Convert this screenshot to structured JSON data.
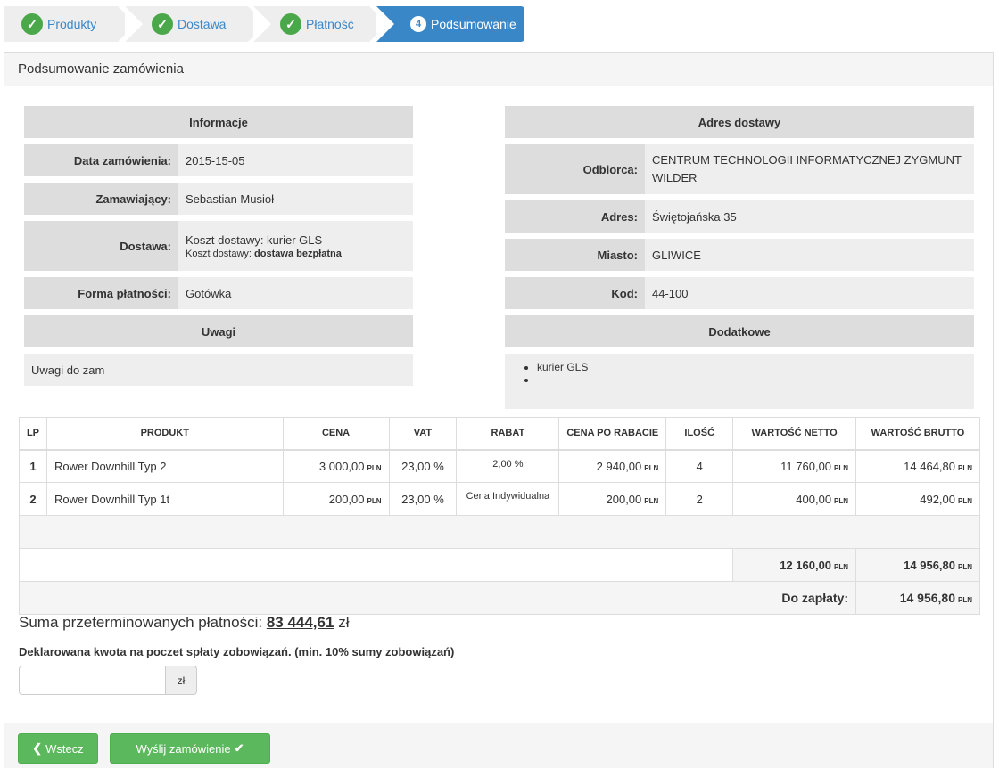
{
  "wizard": {
    "steps": [
      {
        "label": "Produkty"
      },
      {
        "label": "Dostawa"
      },
      {
        "label": "Płatność"
      },
      {
        "label": "Podsumowanie",
        "number": "4"
      }
    ]
  },
  "panel": {
    "title": "Podsumowanie zamówienia"
  },
  "info": {
    "header": "Informacje",
    "rows": [
      {
        "label": "Data zamówienia:",
        "value": "2015-15-05"
      },
      {
        "label": "Zamawiający:",
        "value": "Sebastian Musioł"
      },
      {
        "label": "Dostawa:",
        "value": "Koszt dostawy: kurier GLS",
        "sub_label": "Koszt dostawy:",
        "sub_value": "dostawa bezpłatna"
      },
      {
        "label": "Forma płatności:",
        "value": "Gotówka"
      }
    ],
    "notes_header": "Uwagi",
    "notes": "Uwagi do zam"
  },
  "address": {
    "header": "Adres dostawy",
    "rows": [
      {
        "label": "Odbiorca:",
        "value": "CENTRUM TECHNOLOGII INFORMATYCZNEJ ZYGMUNT WILDER"
      },
      {
        "label": "Adres:",
        "value": "Świętojańska 35"
      },
      {
        "label": "Miasto:",
        "value": "GLIWICE"
      },
      {
        "label": "Kod:",
        "value": "44-100"
      }
    ],
    "extra_header": "Dodatkowe",
    "extra_items": [
      "kurier GLS",
      ""
    ]
  },
  "table": {
    "headers": [
      "LP",
      "PRODUKT",
      "CENA",
      "VAT",
      "RABAT",
      "CENA PO RABACIE",
      "ILOŚĆ",
      "WARTOŚĆ NETTO",
      "WARTOŚĆ BRUTTO"
    ],
    "currency": "PLN",
    "rows": [
      {
        "lp": "1",
        "product": "Rower Downhill Typ 2",
        "price": "3 000,00",
        "vat": "23,00 %",
        "discount": "2,00 %",
        "price_after": "2 940,00",
        "qty": "4",
        "net": "11 760,00",
        "gross": "14 464,80"
      },
      {
        "lp": "2",
        "product": "Rower Downhill Typ 1t",
        "price": "200,00",
        "vat": "23,00 %",
        "discount": "Cena Indywidualna",
        "price_after": "200,00",
        "qty": "2",
        "net": "400,00",
        "gross": "492,00"
      }
    ],
    "total_net": "12 160,00",
    "total_gross": "14 956,80",
    "to_pay_label": "Do zapłaty:",
    "to_pay": "14 956,80"
  },
  "overdue": {
    "label": "Suma przeterminowanych płatności:",
    "amount": "83 444,61",
    "currency": "zł"
  },
  "declared": {
    "label": "Deklarowana kwota na poczet spłaty zobowiązań. (min. 10% sumy zobowiązań)",
    "value": "",
    "addon": "zł"
  },
  "buttons": {
    "back": "Wstecz",
    "submit": "Wyślij zamówienie"
  },
  "colors": {
    "primary": "#3a87c8",
    "success": "#5cb85c"
  }
}
